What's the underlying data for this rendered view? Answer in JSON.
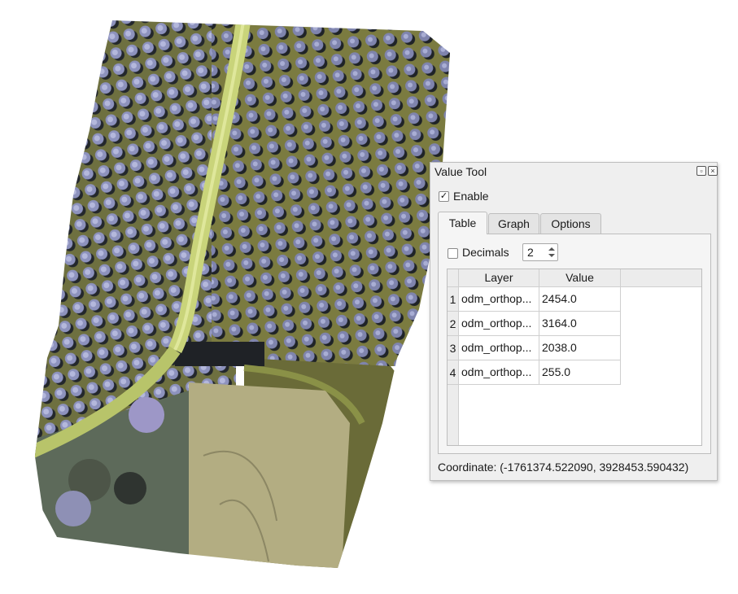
{
  "value_tool": {
    "title": "Value Tool",
    "enable_label": "Enable",
    "enable_checked": "✓",
    "tabs": [
      {
        "label": "Table"
      },
      {
        "label": "Graph"
      },
      {
        "label": "Options"
      }
    ],
    "decimals_label": "Decimals",
    "decimals_value": "2",
    "table": {
      "headers": [
        "Layer",
        "Value"
      ],
      "rows": [
        {
          "num": "1",
          "layer": "odm_orthop...",
          "value": "2454.0"
        },
        {
          "num": "2",
          "layer": "odm_orthop...",
          "value": "3164.0"
        },
        {
          "num": "3",
          "layer": "odm_orthop...",
          "value": "2038.0"
        },
        {
          "num": "4",
          "layer": "odm_orthop...",
          "value": "255.0"
        }
      ]
    },
    "coordinate": "Coordinate: (-1761374.522090, 3928453.590432)"
  },
  "colors": {
    "grass": "#8f9148",
    "tree_canopy": "#8b8fb8",
    "tree_shadow": "#2b2f33",
    "road": "#c9d47a",
    "field": "#b3ad82"
  }
}
